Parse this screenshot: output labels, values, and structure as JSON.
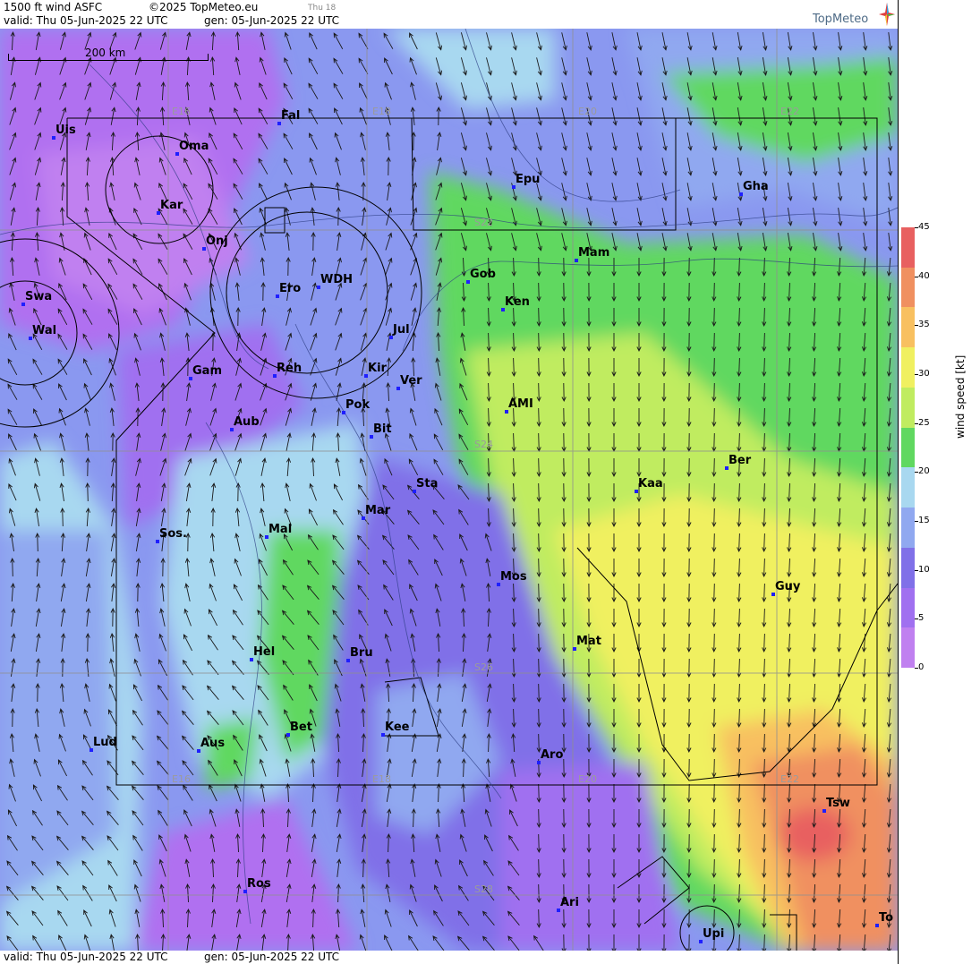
{
  "header": {
    "title": "1500 ft wind ASFC",
    "copyright": "©2025 TopMeteo.eu",
    "hour": "Thu 18",
    "valid": "valid:  Thu  05-Jun-2025  22 UTC",
    "generated": "gen: 05-Jun-2025 22 UTC",
    "logo": "TopMeteo"
  },
  "footer": {
    "valid": "valid:  Thu  05-Jun-2025  22 UTC",
    "generated": "gen: 05-Jun-2025 22 UTC"
  },
  "scale_bar": "200 km",
  "grid_labels": {
    "longitudes": [
      "E16",
      "E18",
      "E20",
      "E22"
    ],
    "latitudes": [
      "S22",
      "S24",
      "S26",
      "S28"
    ]
  },
  "cities": [
    "Uis",
    "Oma",
    "Fal",
    "Kar",
    "Onj",
    "Epu",
    "Gha",
    "Mam",
    "Gob",
    "Ken",
    "WDH",
    "Ero",
    "Swa",
    "Wal",
    "Jul",
    "Gam",
    "Reh",
    "Kir",
    "Ver",
    "Pok",
    "AMI",
    "Aub",
    "Bit",
    "Ber",
    "Sta",
    "Kaa",
    "Mar",
    "Sos.",
    "Mal",
    "Mos",
    "Guy",
    "Mat",
    "Hel",
    "Bru",
    "Kee",
    "Bet",
    "Aus",
    "Lud",
    "Aro",
    "Tsw",
    "Ros",
    "Ari",
    "Upi",
    "To"
  ],
  "colorbar": {
    "title": "wind speed [kt]",
    "ticks": [
      "0",
      "5",
      "10",
      "15",
      "20",
      "25",
      "30",
      "35",
      "40",
      "45"
    ],
    "colors": [
      "#c080f0",
      "#a070f0",
      "#8070e8",
      "#90a8f0",
      "#a8d8f0",
      "#60d860",
      "#c0ec60",
      "#f0f060",
      "#f8c060",
      "#f09060",
      "#e86060"
    ]
  }
}
